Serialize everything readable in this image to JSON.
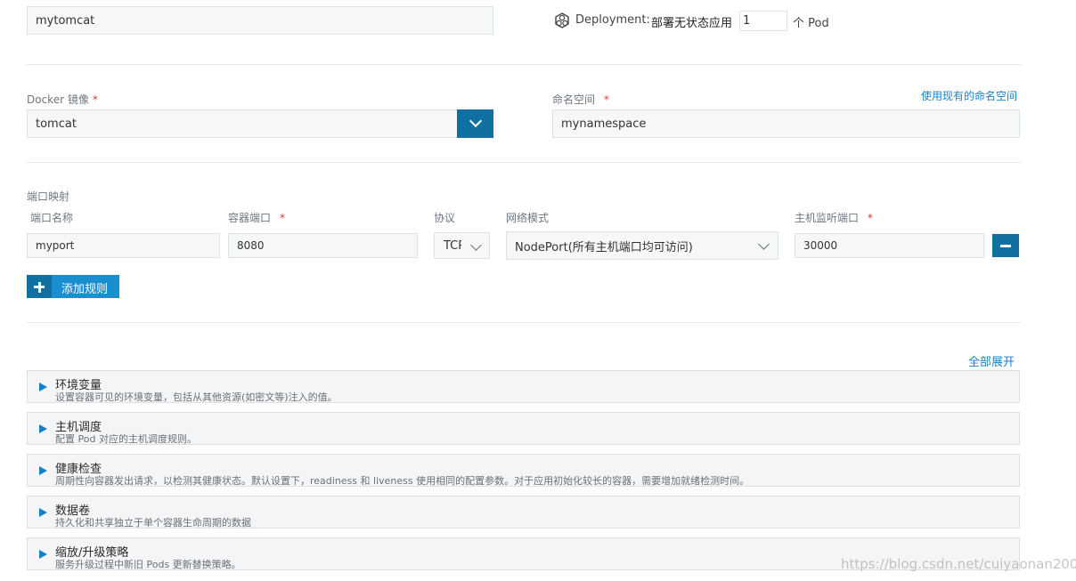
{
  "app_name": {
    "value": "mytomcat"
  },
  "deployment": {
    "label": "Deployment:",
    "desc": "部署无状态应用",
    "count": "1",
    "unit": "个 Pod"
  },
  "docker_image": {
    "label": "Docker 镜像",
    "required": "*",
    "value": "tomcat"
  },
  "namespace": {
    "label": "命名空间",
    "required": "*",
    "value": "mynamespace",
    "link": "使用现有的命名空间"
  },
  "port_mapping": {
    "title": "端口映射",
    "headers": {
      "name": "端口名称",
      "container_port": "容器端口",
      "protocol": "协议",
      "network_mode": "网络模式",
      "host_port": "主机监听端口"
    },
    "required": "*",
    "row": {
      "name": "myport",
      "container_port": "8080",
      "protocol": "TCP",
      "network_mode": "NodePort(所有主机端口均可访问)",
      "host_port": "30000"
    },
    "add_rule": "添加规则"
  },
  "expand_all": "全部展开",
  "sections": [
    {
      "title": "环境变量",
      "desc": "设置容器可见的环境变量，包括从其他资源(如密文等)注入的值。"
    },
    {
      "title": "主机调度",
      "desc": "配置 Pod 对应的主机调度规则。"
    },
    {
      "title": "健康检查",
      "desc": "周期性向容器发出请求，以检测其健康状态。默认设置下，readiness 和 liveness 使用相同的配置参数。对于应用初始化较长的容器，需要增加就绪检测时间。"
    },
    {
      "title": "数据卷",
      "desc": "持久化和共享独立于单个容器生命周期的数据"
    },
    {
      "title": "缩放/升级策略",
      "desc": "服务升级过程中新旧 Pods 更新替换策略。"
    }
  ],
  "watermark": "https://blog.csdn.net/cuiyaonan2000",
  "colors": {
    "accent": "#0f70a1",
    "link": "#1a82c4",
    "required": "#d33b3b"
  }
}
